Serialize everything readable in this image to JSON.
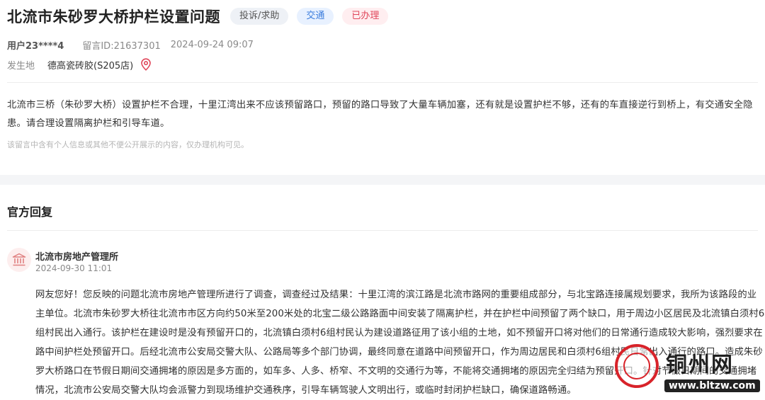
{
  "header": {
    "title": "北流市朱砂罗大桥护栏设置问题",
    "tags": {
      "category": "投诉/求助",
      "field": "交通",
      "status": "已办理"
    }
  },
  "meta": {
    "user": "用户23****4",
    "message_id": "留言ID:21637301",
    "datetime": "2024-09-24 09:07"
  },
  "location": {
    "label": "发生地",
    "value": "德高瓷砖胶(S205店)"
  },
  "message": {
    "body": "北流市三桥（朱砂罗大桥）设置护栏不合理，十里江湾出来不应该预留路口，预留的路口导致了大量车辆加塞，还有就是设置护栏不够，还有的车直接逆行到桥上，有交通安全隐患。请合理设置隔离护栏和引导车道。",
    "privacy_notice": "该留言中含有个人信息或其他不便公开展示的内容，仅办理机构可见。"
  },
  "reply": {
    "heading": "官方回复",
    "org_name": "北流市房地产管理所",
    "datetime": "2024-09-30 11:01",
    "body": "网友您好！您反映的问题北流市房地产管理所进行了调查，调查经过及结果：十里江湾的滨江路是北流市路网的重要组成部分，与北宝路连接属规划要求，我所为该路段的业主单位。北流市朱砂罗大桥往北流市市区方向约50米至200米处的北宝二级公路路面中间安装了隔离护栏，并在护栏中间预留了两个缺口，用于周边小区居民及北流镇白须村6组村民出入通行。该护栏在建设时是没有预留开口的，北流镇白须村6组村民认为建设道路征用了该小组的土地，如不预留开口将对他们的日常通行造成较大影响，强烈要求在路中间护栏处预留开口。后经北流市公安局交警大队、公路局等多个部门协调，最终同意在道路中间预留开口，作为周边居民和白须村6组村民日常出入通行的路口。造成朱砂罗大桥路口在节假日期间交通拥堵的原因是多方面的，如车多、人多、桥窄、不文明的交通行为等，不能将交通拥堵的原因完全归结为预留开口。针对节假日期间的交通拥堵情况，北流市公安局交警大队均会派警力到现场维护交通秩序，引导车辆驾驶人文明出行，或临时封闭护栏缺口，确保道路畅通。"
  },
  "watermark": {
    "title": "铜州网",
    "url": "www.bltzw.com"
  },
  "colors": {
    "tag_field": "#3b7ddd",
    "tag_status": "#e0465a",
    "location_icon": "#e0465a",
    "watermark_seal": "#d8232a"
  }
}
